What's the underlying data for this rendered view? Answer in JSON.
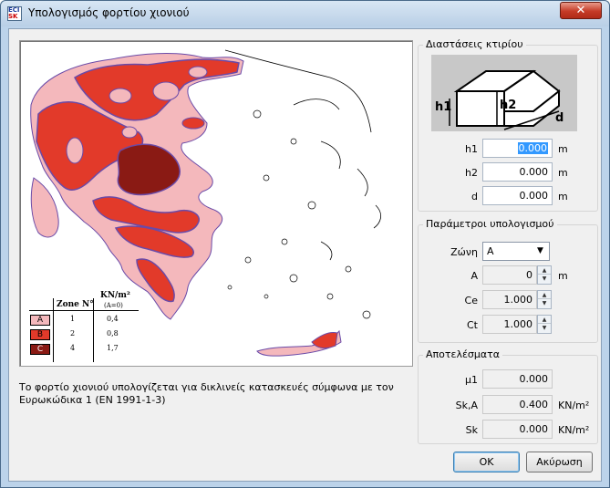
{
  "window": {
    "title": "Υπολογισμός φορτίου χιονιού",
    "close_glyph": "✕"
  },
  "app_icon": {
    "line1": "ECI",
    "line2": "SK"
  },
  "caption": "Το φορτίο χιονιού υπολογίζεται για δικλινείς κατασκευές σύμφωνα με τον Ευρωκώδικα 1 (EN 1991-1-3)",
  "legend": {
    "header_zone": "Zone N°",
    "header_load": "KN/m²",
    "header_sub": "(A=0)",
    "rows": [
      {
        "zone": "A",
        "n": "1",
        "value": "0,4"
      },
      {
        "zone": "B",
        "n": "2",
        "value": "0,8"
      },
      {
        "zone": "C",
        "n": "4",
        "value": "1,7"
      }
    ],
    "colors": {
      "A": "#f4b8bc",
      "B": "#e23a2a",
      "C": "#8a1a14"
    }
  },
  "dimensions": {
    "title": "Διαστάσεις κτιρίου",
    "diagram": {
      "h1": "h1",
      "h2": "h2",
      "d": "d"
    },
    "h1": {
      "label": "h1",
      "value": "0.000",
      "unit": "m"
    },
    "h2": {
      "label": "h2",
      "value": "0.000",
      "unit": "m"
    },
    "d": {
      "label": "d",
      "value": "0.000",
      "unit": "m"
    }
  },
  "params": {
    "title": "Παράμετροι υπολογισμού",
    "zone": {
      "label": "Ζώνη",
      "value": "A"
    },
    "A": {
      "label": "A",
      "value": "0",
      "unit": "m"
    },
    "Ce": {
      "label": "Ce",
      "value": "1.000"
    },
    "Ct": {
      "label": "Ct",
      "value": "1.000"
    }
  },
  "results": {
    "title": "Αποτελέσματα",
    "mu1": {
      "label": "μ1",
      "value": "0.000"
    },
    "SkA": {
      "label": "Sk,A",
      "value": "0.400",
      "unit": "KN/m²"
    },
    "Sk": {
      "label": "Sk",
      "value": "0.000",
      "unit": "KN/m²"
    }
  },
  "buttons": {
    "ok": "OK",
    "cancel": "Ακύρωση"
  }
}
